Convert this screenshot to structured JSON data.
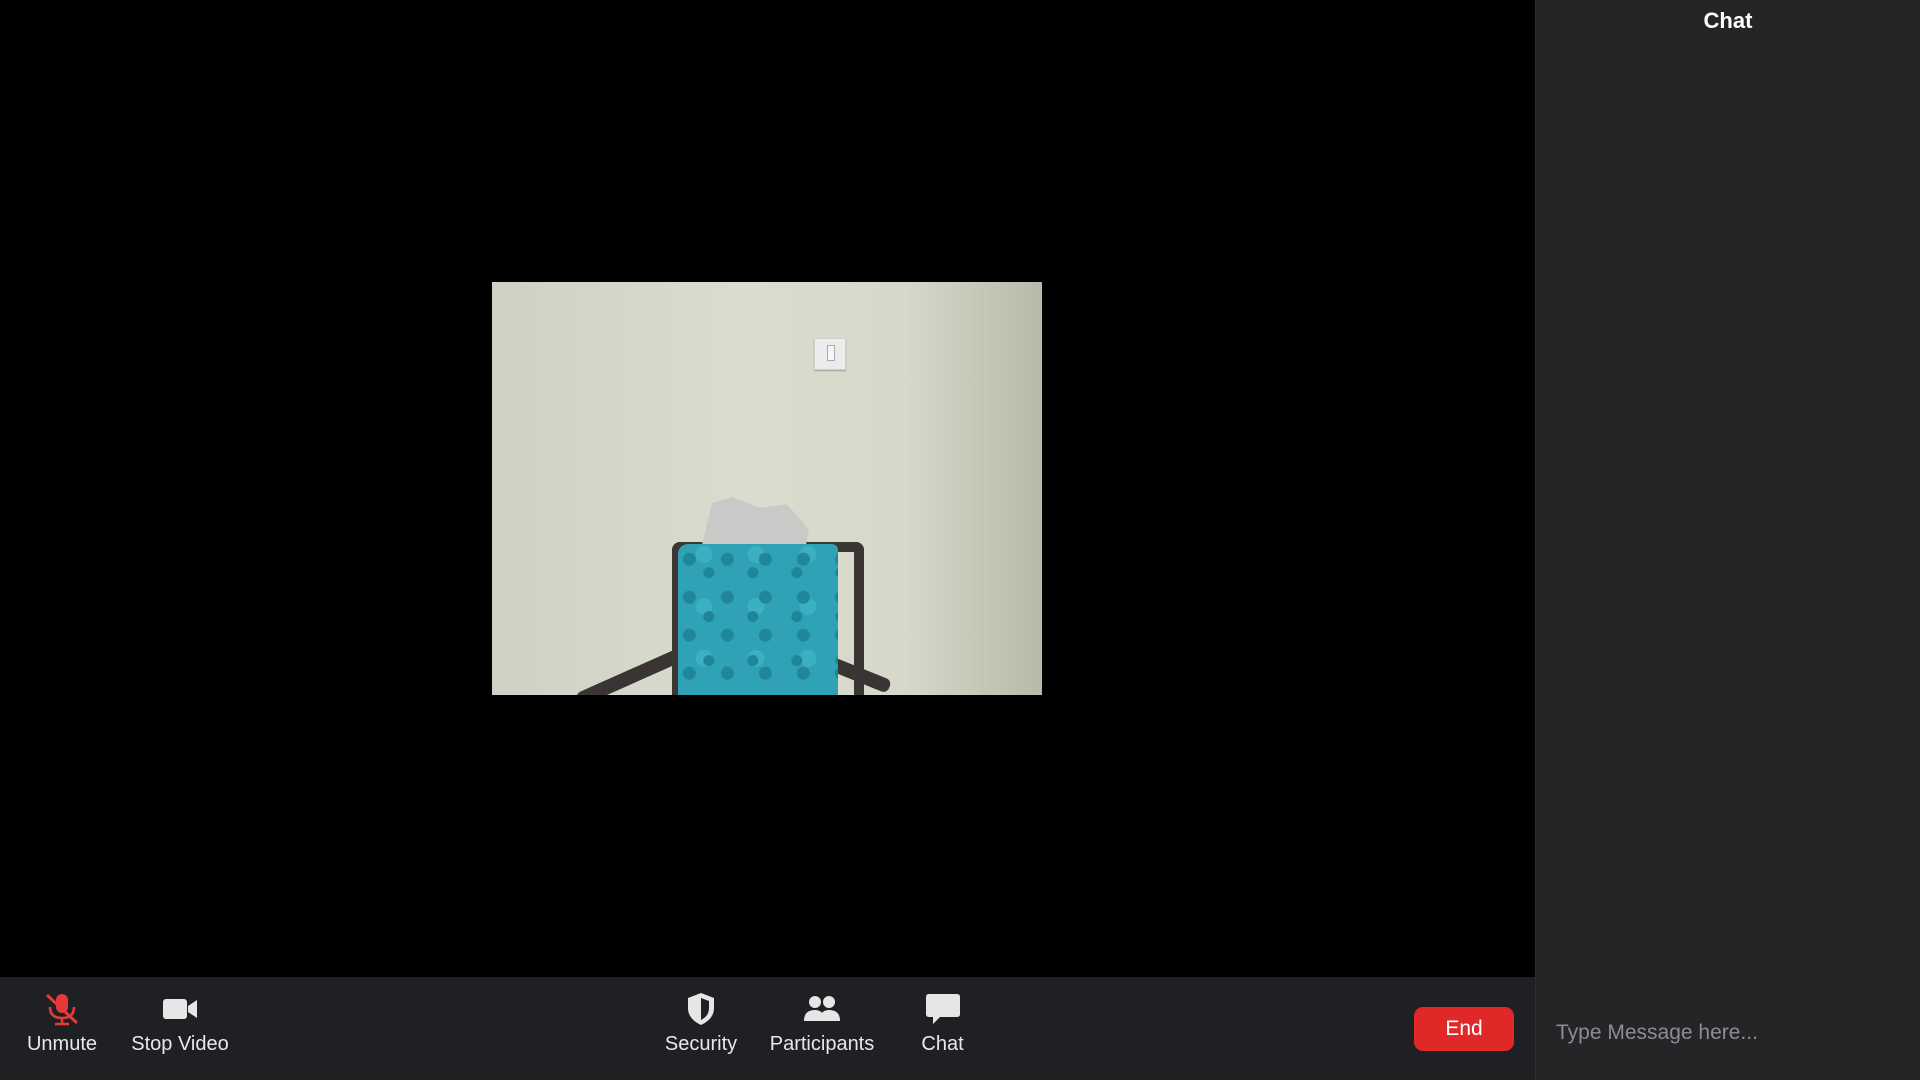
{
  "toolbar": {
    "unmute_label": "Unmute",
    "stop_video_label": "Stop Video",
    "security_label": "Security",
    "participants_label": "Participants",
    "chat_label": "Chat",
    "end_label": "End",
    "icons": {
      "unmute": "mic-muted-icon",
      "stop_video": "video-camera-icon",
      "security": "shield-icon",
      "participants": "participants-icon",
      "chat": "chat-bubble-icon"
    }
  },
  "chat_panel": {
    "title": "Chat",
    "input_placeholder": "Type Message here..."
  },
  "colors": {
    "end_button": "#e02828",
    "muted_icon": "#e5393a",
    "toolbar_bg": "#1f2023",
    "panel_bg": "#242527"
  }
}
